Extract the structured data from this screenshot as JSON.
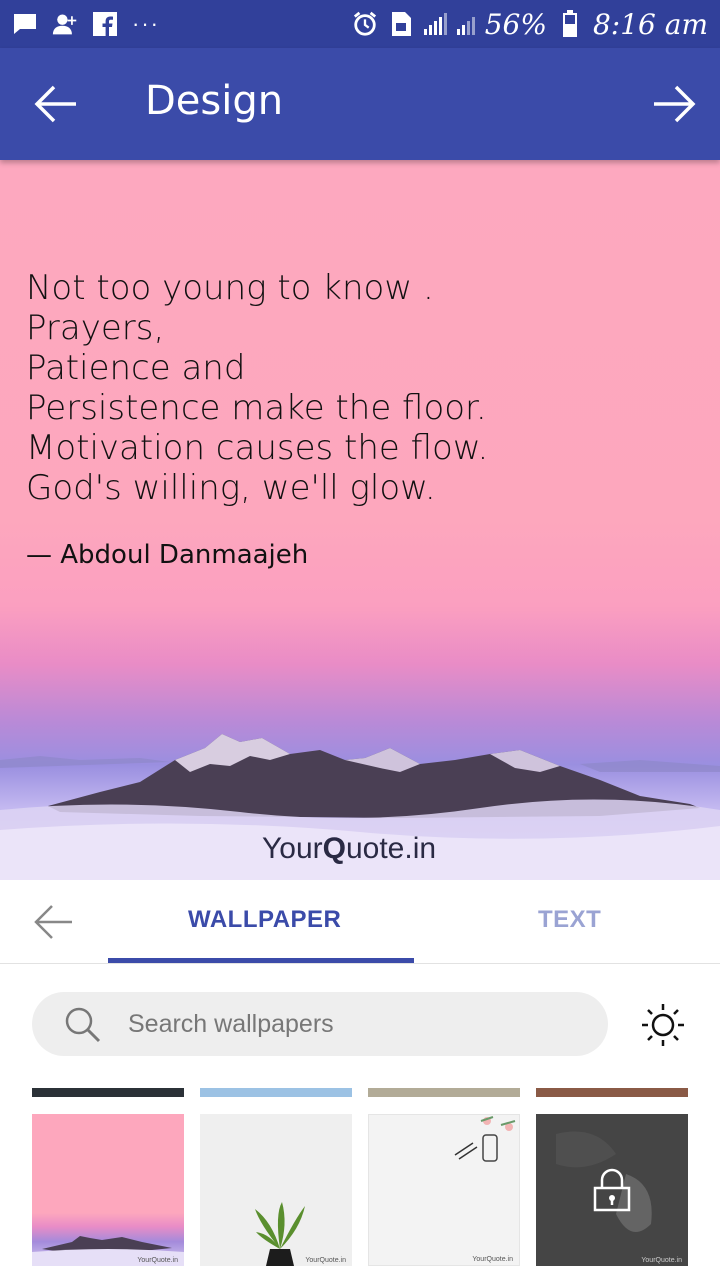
{
  "status_bar": {
    "battery": "56%",
    "time": "8:16 am",
    "dots": "···"
  },
  "app_bar": {
    "title": "Design"
  },
  "preview": {
    "quote_lines": [
      "Not too young to know .",
      "Prayers,",
      "Patience and",
      "Persistence make the floor.",
      "Motivation causes the flow.",
      "God's willing, we'll glow."
    ],
    "author": "— Abdoul Danmaajeh",
    "watermark_prefix": "Your",
    "watermark_q": "Q",
    "watermark_suffix": "uote.in"
  },
  "tabs": {
    "wallpaper": "WALLPAPER",
    "text": "TEXT",
    "active": "wallpaper"
  },
  "search": {
    "placeholder": "Search wallpapers",
    "value": ""
  },
  "thumbnails": [
    {
      "name": "pink-mountain",
      "strip_color": "#2b3137",
      "locked": false,
      "mark": "YourQuote.in"
    },
    {
      "name": "palm-plant",
      "strip_color": "#9cc2e4",
      "locked": false,
      "mark": "YourQuote.in"
    },
    {
      "name": "desk-phone",
      "strip_color": "#b2ab97",
      "locked": false,
      "mark": "YourQuote.in"
    },
    {
      "name": "dark-photo",
      "strip_color": "#8a5a46",
      "locked": true,
      "mark": "YourQuote.in"
    }
  ],
  "colors": {
    "status_bar": "#31409a",
    "app_bar": "#3b4ba9",
    "tab_active": "#3b4ba9",
    "tab_inactive": "#9aa3d3"
  }
}
